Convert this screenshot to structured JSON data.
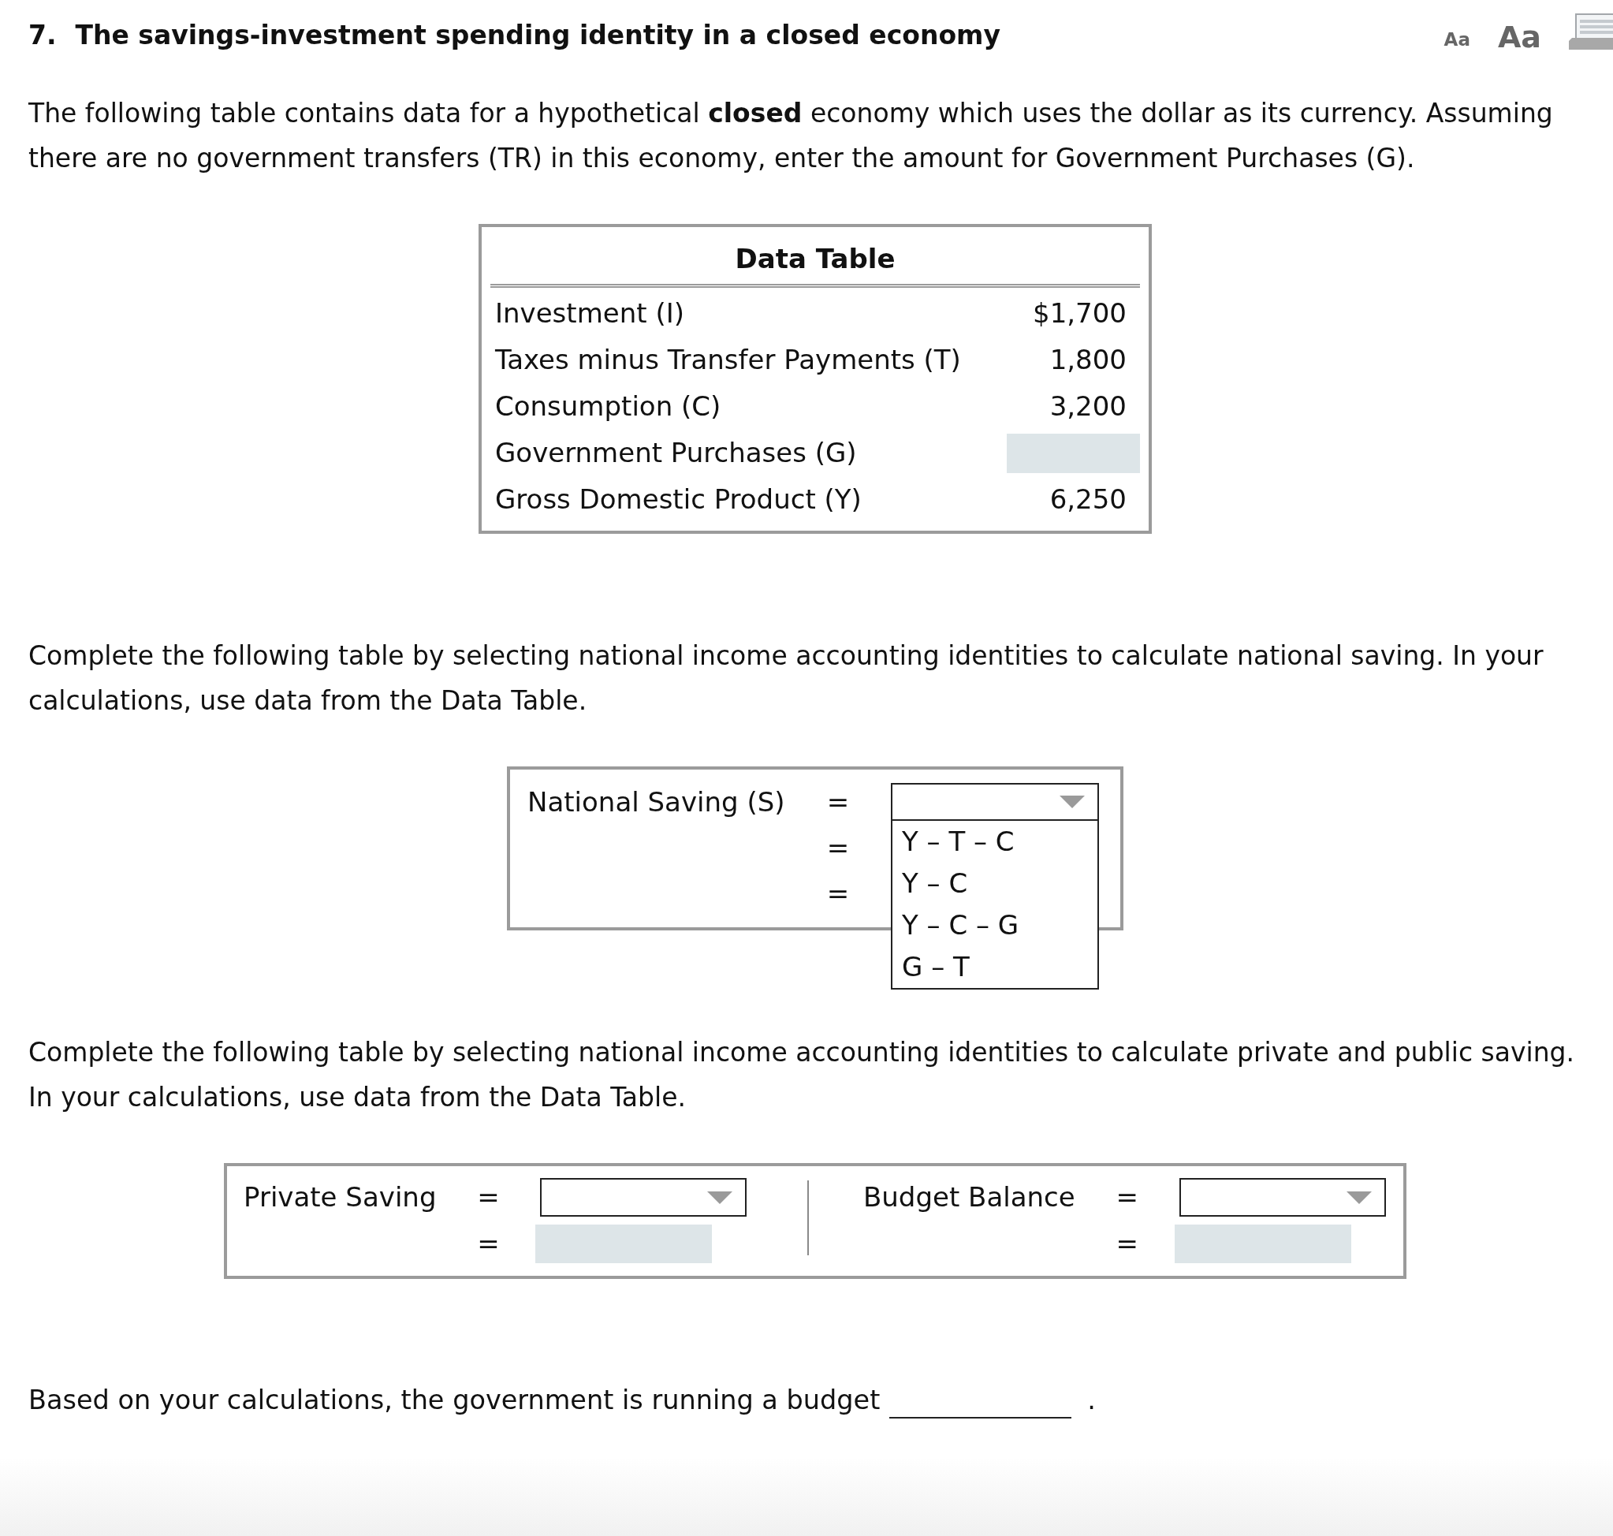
{
  "question": {
    "number": "7.",
    "title": "The savings-investment spending identity in a closed economy"
  },
  "toolbar": {
    "text_size_buttons": [
      {
        "label": "Aa",
        "kind": "small"
      },
      {
        "label": "Aa",
        "kind": "large"
      }
    ]
  },
  "intro": "The following table contains data for a hypothetical **closed** economy which uses the dollar as its currency. Assuming there are no government transfers (TR) in this economy, enter the amount for Government Purchases (G).",
  "data_table": {
    "title": "Data Table",
    "rows": [
      {
        "label": "Investment (I)",
        "kind": "value",
        "value": "$1,700"
      },
      {
        "label": "Taxes minus Transfer Payments (T)",
        "kind": "value",
        "value": "1,800"
      },
      {
        "label": "Consumption (C)",
        "kind": "value",
        "value": "3,200"
      },
      {
        "label": "Government Purchases (G)",
        "kind": "input"
      },
      {
        "label": "Gross Domestic Product (Y)",
        "kind": "value",
        "value": "6,250"
      }
    ]
  },
  "national_saving": {
    "instructions": "Complete the following table by selecting national income accounting identities to calculate national saving. In your calculations, use data from the Data Table.",
    "label": "National Saving (S)",
    "rows": [
      {
        "sign": "=",
        "kind": "dropdown",
        "expanded": true,
        "options": [
          {
            "label": "Y – T – C",
            "selected": false
          },
          {
            "label": "Y – C",
            "selected": false
          },
          {
            "label": "Y – C – G",
            "selected": false
          },
          {
            "label": "G – T",
            "selected": false
          }
        ]
      },
      {
        "sign": "=",
        "kind": "blank"
      },
      {
        "sign": "=",
        "kind": "blank"
      }
    ]
  },
  "private_public_saving": {
    "instructions": "Complete the following table by selecting national income accounting identities to calculate private and public saving. In your calculations, use data from the Data Table.",
    "columns": [
      {
        "label": "Private Saving",
        "rows": [
          {
            "sign": "=",
            "kind": "dropdown",
            "expanded": false
          },
          {
            "sign": "=",
            "kind": "input"
          }
        ]
      },
      {
        "label": "Budget Balance",
        "rows": [
          {
            "sign": "=",
            "kind": "dropdown",
            "expanded": false
          },
          {
            "sign": "=",
            "kind": "input"
          }
        ]
      }
    ]
  },
  "conclusion": {
    "text": "Based on your calculations, the government is running a budget",
    "end": "."
  }
}
